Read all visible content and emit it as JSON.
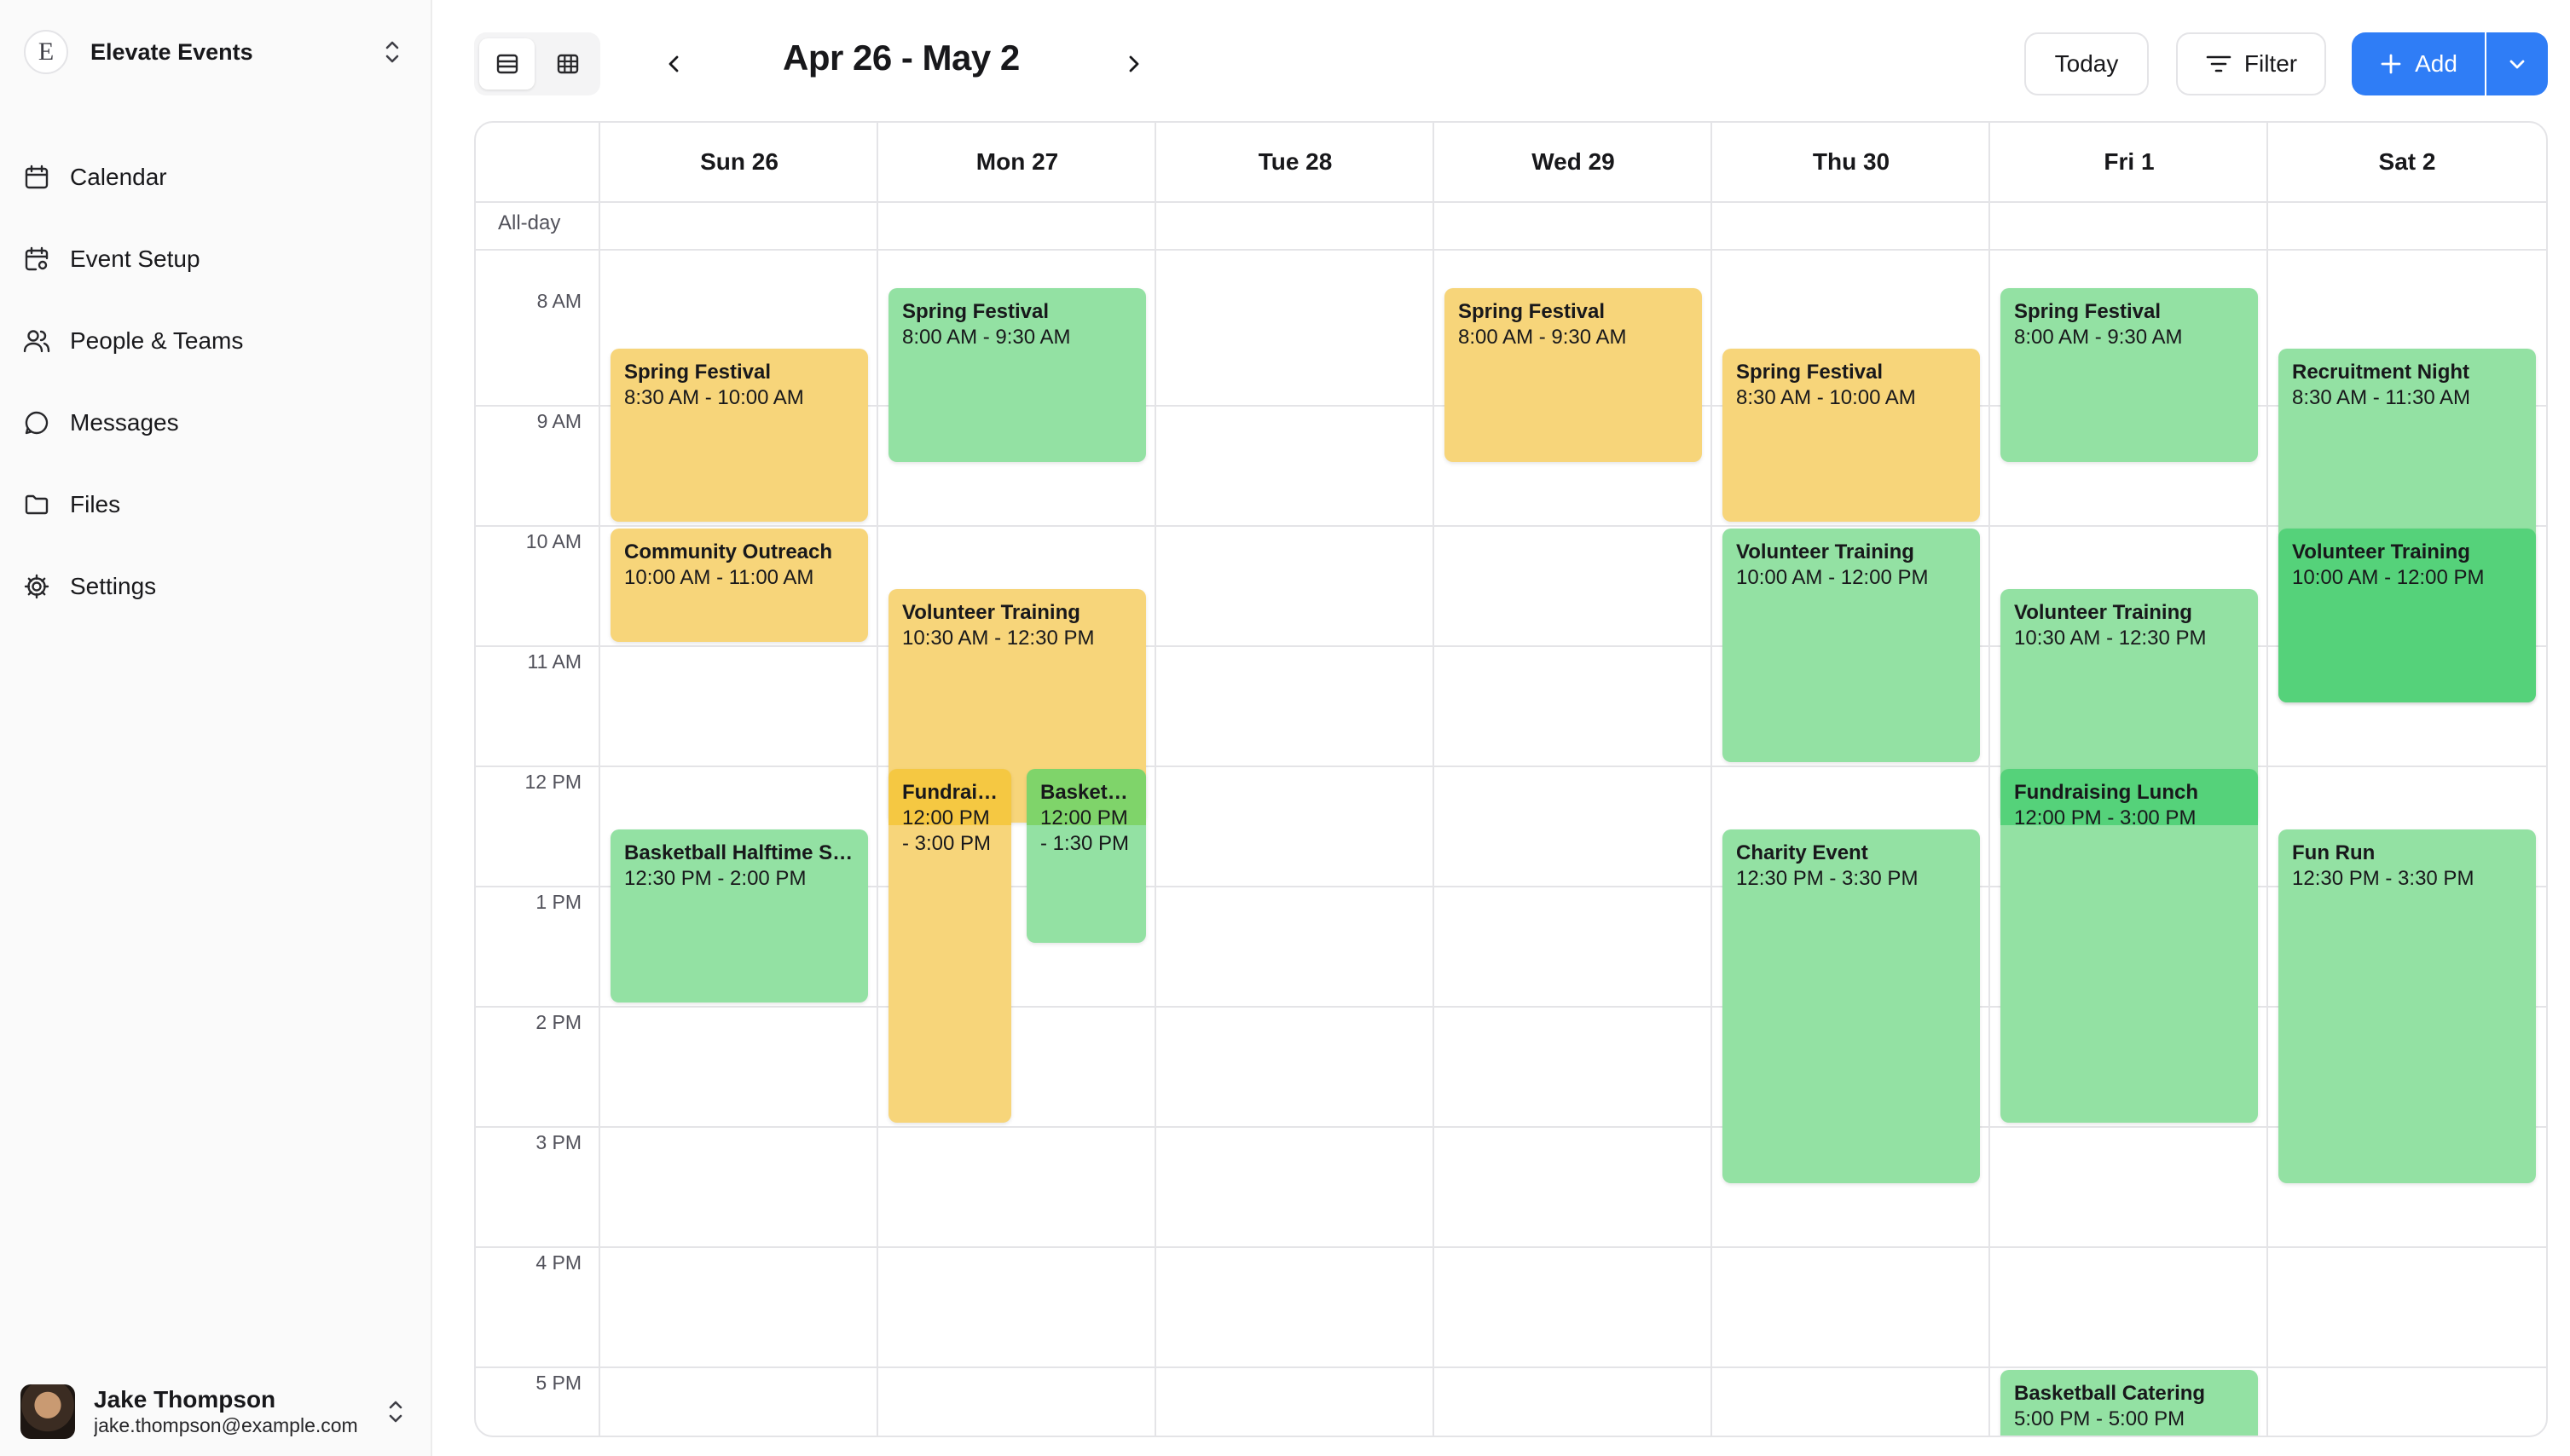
{
  "workspace": {
    "name": "Elevate Events",
    "logo_letter": "E"
  },
  "sidebar": {
    "items": [
      {
        "label": "Calendar",
        "icon": "calendar-icon"
      },
      {
        "label": "Event Setup",
        "icon": "calendar-settings-icon"
      },
      {
        "label": "People & Teams",
        "icon": "people-icon"
      },
      {
        "label": "Messages",
        "icon": "message-icon"
      },
      {
        "label": "Files",
        "icon": "folder-icon"
      },
      {
        "label": "Settings",
        "icon": "gear-icon"
      }
    ]
  },
  "user": {
    "name": "Jake Thompson",
    "email": "jake.thompson@example.com"
  },
  "toolbar": {
    "date_range": "Apr 26 - May 2",
    "today_label": "Today",
    "filter_label": "Filter",
    "add_label": "Add",
    "accent_color": "#2f7df6"
  },
  "calendar": {
    "days": [
      "Sun 26",
      "Mon 27",
      "Tue 28",
      "Wed 29",
      "Thu 30",
      "Fri 1",
      "Sat 2"
    ],
    "all_day_label": "All-day",
    "hours": [
      "8 AM",
      "9 AM",
      "10 AM",
      "11 AM",
      "12 PM",
      "1 PM",
      "2 PM",
      "3 PM",
      "4 PM",
      "5 PM"
    ],
    "colors": {
      "yellow": "#f7d57a",
      "green": "#93e1a3",
      "dark_green": "#55d27a",
      "dark_yellow": "#f5c842"
    },
    "events": [
      {
        "day": 0,
        "title": "Spring Festival",
        "time": "8:30 AM - 10:00 AM",
        "start": 8.5,
        "end": 10,
        "color": "yellow"
      },
      {
        "day": 0,
        "title": "Community Outreach",
        "time": "10:00 AM - 11:00 AM",
        "start": 10,
        "end": 11,
        "color": "yellow"
      },
      {
        "day": 0,
        "title": "Basketball Halftime Show",
        "time": "12:30 PM - 2:00 PM",
        "start": 12.5,
        "end": 14,
        "color": "green"
      },
      {
        "day": 1,
        "title": "Spring Festival",
        "time": "8:00 AM - 9:30 AM",
        "start": 8,
        "end": 9.5,
        "color": "green"
      },
      {
        "day": 1,
        "title": "Volunteer Training",
        "time": "10:30 AM - 12:30 PM",
        "start": 10.5,
        "end": 12.5,
        "color": "yellow"
      },
      {
        "day": 1,
        "title": "Fundraising Lunch",
        "time": "12:00 PM - 3:00 PM",
        "start": 12,
        "end": 15,
        "color": "yellow",
        "half": "left"
      },
      {
        "day": 1,
        "title": "Basketball Catering",
        "time": "12:00 PM - 1:30 PM",
        "start": 12,
        "end": 13.5,
        "color": "green",
        "half": "right"
      },
      {
        "day": 3,
        "title": "Spring Festival",
        "time": "8:00 AM - 9:30 AM",
        "start": 8,
        "end": 9.5,
        "color": "yellow"
      },
      {
        "day": 4,
        "title": "Spring Festival",
        "time": "8:30 AM - 10:00 AM",
        "start": 8.5,
        "end": 10,
        "color": "yellow"
      },
      {
        "day": 4,
        "title": "Volunteer Training",
        "time": "10:00 AM - 12:00 PM",
        "start": 10,
        "end": 12,
        "color": "green"
      },
      {
        "day": 4,
        "title": "Charity Event",
        "time": "12:30 PM - 3:30 PM",
        "start": 12.5,
        "end": 15.5,
        "color": "green"
      },
      {
        "day": 5,
        "title": "Spring Festival",
        "time": "8:00 AM - 9:30 AM",
        "start": 8,
        "end": 9.5,
        "color": "green"
      },
      {
        "day": 5,
        "title": "Volunteer Training",
        "time": "10:30 AM - 12:30 PM",
        "start": 10.5,
        "end": 12.5,
        "color": "green"
      },
      {
        "day": 5,
        "title": "Fundraising Lunch",
        "time": "12:00 PM - 3:00 PM",
        "start": 12,
        "end": 15,
        "color": "green"
      },
      {
        "day": 5,
        "title": "Basketball Catering",
        "time": "5:00 PM - 5:00 PM",
        "start": 17,
        "end": 18,
        "color": "green"
      },
      {
        "day": 6,
        "title": "Recruitment Night",
        "time": "8:30 AM - 11:30 AM",
        "start": 8.5,
        "end": 11.5,
        "color": "green"
      },
      {
        "day": 6,
        "title": "Volunteer Training",
        "time": "10:00 AM - 12:00 PM",
        "start": 10,
        "end": 11.5,
        "color": "dark_green"
      },
      {
        "day": 6,
        "title": "Fun Run",
        "time": "12:30 PM - 3:30 PM",
        "start": 12.5,
        "end": 15.5,
        "color": "green"
      }
    ]
  }
}
